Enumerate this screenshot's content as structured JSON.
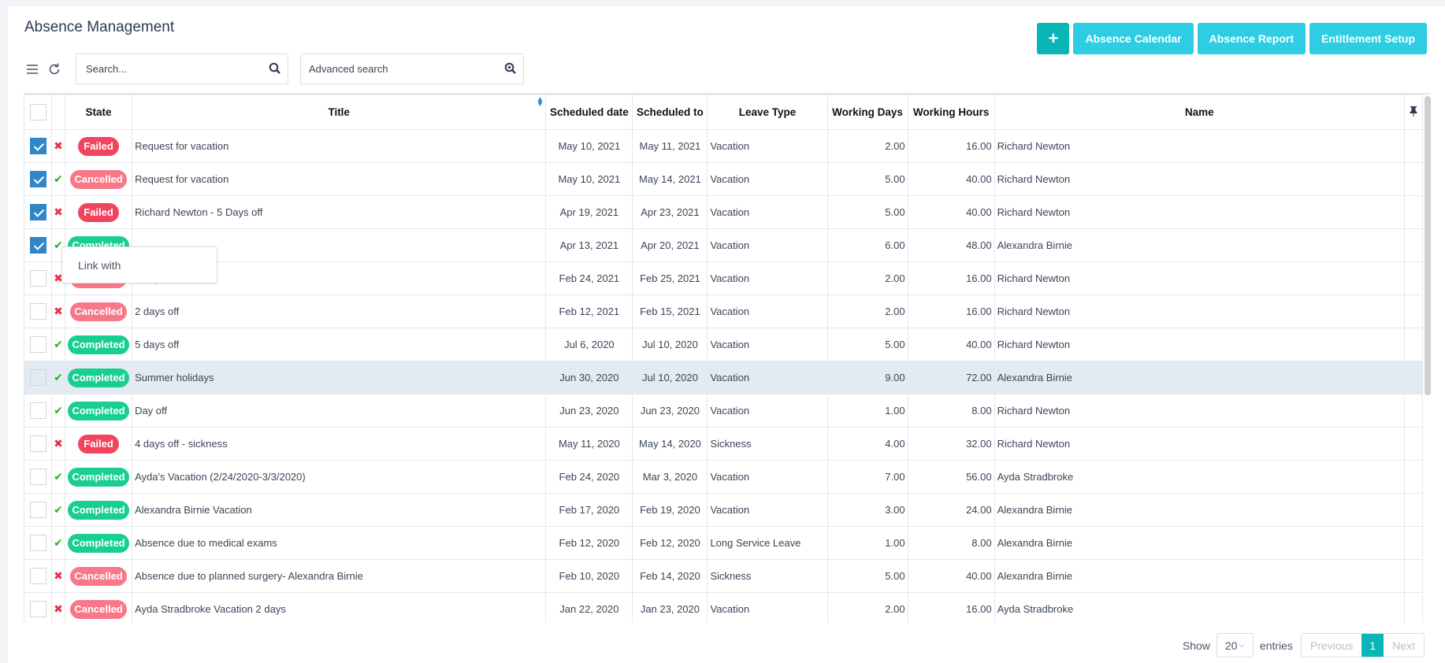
{
  "header": {
    "title": "Absence Management",
    "buttons": {
      "add": "+",
      "calendar": "Absence Calendar",
      "report": "Absence Report",
      "entitlement": "Entitlement Setup"
    }
  },
  "toolbar": {
    "search_placeholder": "Search...",
    "advanced_search": "Advanced search",
    "icons": [
      "menu-icon",
      "refresh-icon",
      "search-icon",
      "zoom-in-icon"
    ]
  },
  "table": {
    "columns": {
      "state": "State",
      "title": "Title",
      "scheduled_date": "Scheduled date",
      "scheduled_to": "Scheduled to",
      "leave_type": "Leave Type",
      "working_days": "Working Days",
      "working_hours": "Working Hours",
      "name": "Name"
    },
    "rows": [
      {
        "checked": true,
        "approved": false,
        "state": "Failed",
        "title": "Request for vacation",
        "from": "May 10, 2021",
        "to": "May 11, 2021",
        "type": "Vacation",
        "days": "2.00",
        "hours": "16.00",
        "name": "Richard Newton"
      },
      {
        "checked": true,
        "approved": true,
        "state": "Cancelled",
        "title": "Request for vacation",
        "from": "May 10, 2021",
        "to": "May 14, 2021",
        "type": "Vacation",
        "days": "5.00",
        "hours": "40.00",
        "name": "Richard Newton"
      },
      {
        "checked": true,
        "approved": false,
        "state": "Failed",
        "title": "Richard Newton - 5 Days off",
        "from": "Apr 19, 2021",
        "to": "Apr 23, 2021",
        "type": "Vacation",
        "days": "5.00",
        "hours": "40.00",
        "name": "Richard Newton"
      },
      {
        "checked": true,
        "approved": true,
        "state": "Completed",
        "title": "",
        "from": "Apr 13, 2021",
        "to": "Apr 20, 2021",
        "type": "Vacation",
        "days": "6.00",
        "hours": "48.00",
        "name": "Alexandra Birnie"
      },
      {
        "checked": false,
        "approved": false,
        "state": "Cancelled",
        "title": "2 days off",
        "from": "Feb 24, 2021",
        "to": "Feb 25, 2021",
        "type": "Vacation",
        "days": "2.00",
        "hours": "16.00",
        "name": "Richard Newton"
      },
      {
        "checked": false,
        "approved": false,
        "state": "Cancelled",
        "title": "2 days off",
        "from": "Feb 12, 2021",
        "to": "Feb 15, 2021",
        "type": "Vacation",
        "days": "2.00",
        "hours": "16.00",
        "name": "Richard Newton"
      },
      {
        "checked": false,
        "approved": true,
        "state": "Completed",
        "title": "5 days off",
        "from": "Jul 6, 2020",
        "to": "Jul 10, 2020",
        "type": "Vacation",
        "days": "5.00",
        "hours": "40.00",
        "name": "Richard Newton"
      },
      {
        "checked": false,
        "approved": true,
        "state": "Completed",
        "title": "Summer holidays",
        "from": "Jun 30, 2020",
        "to": "Jul 10, 2020",
        "type": "Vacation",
        "days": "9.00",
        "hours": "72.00",
        "name": "Alexandra Birnie",
        "highlighted": true
      },
      {
        "checked": false,
        "approved": true,
        "state": "Completed",
        "title": "Day off",
        "from": "Jun 23, 2020",
        "to": "Jun 23, 2020",
        "type": "Vacation",
        "days": "1.00",
        "hours": "8.00",
        "name": "Richard Newton"
      },
      {
        "checked": false,
        "approved": false,
        "state": "Failed",
        "title": "4 days off - sickness",
        "from": "May 11, 2020",
        "to": "May 14, 2020",
        "type": "Sickness",
        "days": "4.00",
        "hours": "32.00",
        "name": "Richard Newton"
      },
      {
        "checked": false,
        "approved": true,
        "state": "Completed",
        "title": "Ayda's Vacation (2/24/2020-3/3/2020)",
        "from": "Feb 24, 2020",
        "to": "Mar 3, 2020",
        "type": "Vacation",
        "days": "7.00",
        "hours": "56.00",
        "name": "Ayda Stradbroke"
      },
      {
        "checked": false,
        "approved": true,
        "state": "Completed",
        "title": "Alexandra Birnie Vacation",
        "from": "Feb 17, 2020",
        "to": "Feb 19, 2020",
        "type": "Vacation",
        "days": "3.00",
        "hours": "24.00",
        "name": "Alexandra Birnie"
      },
      {
        "checked": false,
        "approved": true,
        "state": "Completed",
        "title": "Absence due to medical exams",
        "from": "Feb 12, 2020",
        "to": "Feb 12, 2020",
        "type": "Long Service Leave",
        "days": "1.00",
        "hours": "8.00",
        "name": "Alexandra Birnie"
      },
      {
        "checked": false,
        "approved": false,
        "state": "Cancelled",
        "title": "Absence due to planned surgery- Alexandra Birnie",
        "from": "Feb 10, 2020",
        "to": "Feb 14, 2020",
        "type": "Sickness",
        "days": "5.00",
        "hours": "40.00",
        "name": "Alexandra Birnie"
      },
      {
        "checked": false,
        "approved": false,
        "state": "Cancelled",
        "title": "Ayda Stradbroke Vacation 2 days",
        "from": "Jan 22, 2020",
        "to": "Jan 23, 2020",
        "type": "Vacation",
        "days": "2.00",
        "hours": "16.00",
        "name": "Ayda Stradbroke"
      }
    ]
  },
  "context_menu": {
    "items": [
      "Link with"
    ]
  },
  "footer": {
    "show_label": "Show",
    "page_size": "20",
    "entries_label": "entries",
    "previous": "Previous",
    "current_page": "1",
    "next": "Next"
  },
  "colors": {
    "accent": "#2ecde3",
    "add_button": "#0ab5b8",
    "failed": "#f2445f",
    "cancelled": "#f87889",
    "completed": "#19cf8f",
    "checkbox": "#2f86c8"
  }
}
